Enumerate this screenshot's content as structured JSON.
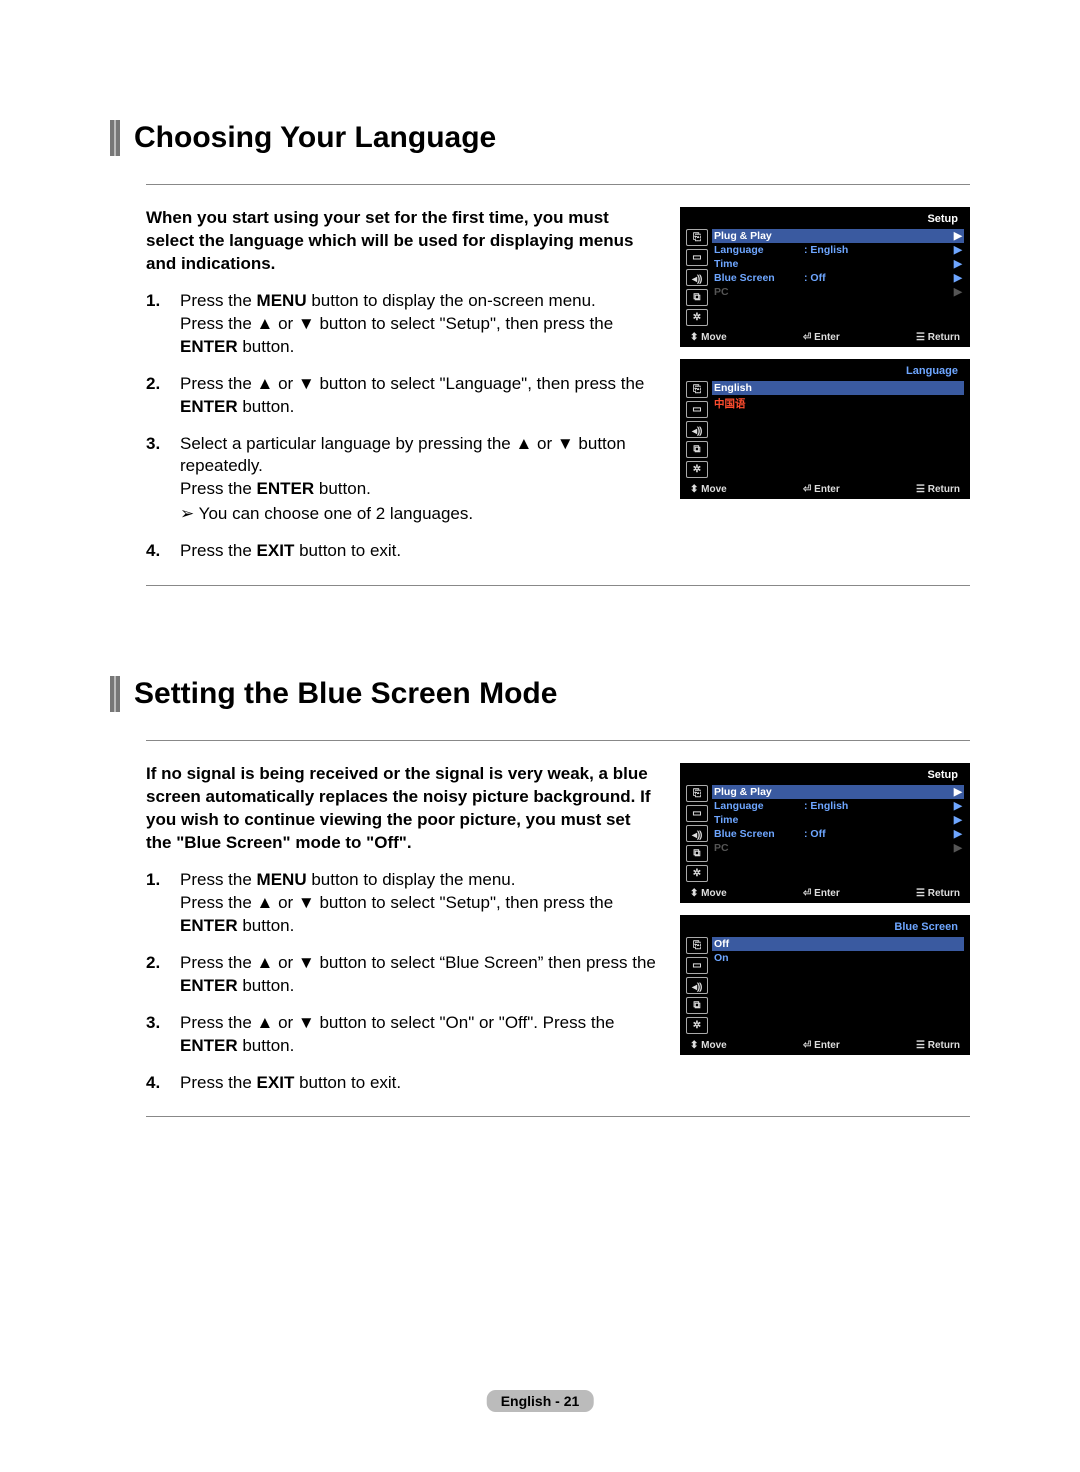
{
  "section1": {
    "title": "Choosing Your Language",
    "intro": "When you start using your set for the first time, you must select the language which will be used for displaying menus and indications.",
    "steps": {
      "s1a": "Press the ",
      "s1b": "MENU",
      "s1c": " button to display the on-screen menu.\nPress the ▲ or ▼ button to select \"Setup\", then press the ",
      "s1d": "ENTER",
      "s1e": " button.",
      "s2a": "Press the ▲ or ▼ button to select \"Language\", then press the ",
      "s2b": "ENTER",
      "s2c": " button.",
      "s3a": "Select a particular language by pressing the ▲ or ▼ button repeatedly.\nPress the ",
      "s3b": "ENTER",
      "s3c": " button.",
      "s3note": "You can choose one of 2 languages.",
      "s4a": "Press the ",
      "s4b": "EXIT",
      "s4c": " button to exit."
    },
    "osd1": {
      "title": "Setup",
      "items": [
        {
          "label": "Plug & Play",
          "value": "",
          "arrow": true,
          "hl": true
        },
        {
          "label": "Language",
          "value": ": English",
          "arrow": true
        },
        {
          "label": "Time",
          "value": "",
          "arrow": true
        },
        {
          "label": "Blue Screen",
          "value": ": Off",
          "arrow": true
        },
        {
          "label": "PC",
          "value": "",
          "arrow": true,
          "dim": true
        }
      ]
    },
    "osd2": {
      "title": "Language",
      "items": [
        {
          "label": "English",
          "hl": true
        },
        {
          "label": "中国语",
          "red": true
        }
      ]
    }
  },
  "section2": {
    "title": "Setting the Blue Screen Mode",
    "intro": "If no signal is being received or the signal is very weak, a blue screen automatically replaces the noisy picture background. If you wish to continue viewing the poor picture, you must set the \"Blue Screen\" mode to \"Off\".",
    "steps": {
      "s1a": "Press the ",
      "s1b": "MENU",
      "s1c": " button to display the menu.\nPress the ▲ or ▼ button to select \"Setup\", then press the ",
      "s1d": "ENTER",
      "s1e": " button.",
      "s2a": "Press the ▲ or ▼ button to select “Blue Screen” then press the ",
      "s2b": "ENTER",
      "s2c": " button.",
      "s3a": "Press the ▲ or ▼ button to select \"On\" or \"Off\". Press the ",
      "s3b": "ENTER",
      "s3c": " button.",
      "s4a": "Press the ",
      "s4b": "EXIT",
      "s4c": " button to exit."
    },
    "osd1": {
      "title": "Setup",
      "items": [
        {
          "label": "Plug & Play",
          "value": "",
          "arrow": true,
          "hl": true
        },
        {
          "label": "Language",
          "value": ": English",
          "arrow": true
        },
        {
          "label": "Time",
          "value": "",
          "arrow": true
        },
        {
          "label": "Blue Screen",
          "value": ": Off",
          "arrow": true
        },
        {
          "label": "PC",
          "value": "",
          "arrow": true,
          "dim": true
        }
      ]
    },
    "osd2": {
      "title": "Blue Screen",
      "items": [
        {
          "label": "Off",
          "hl": true
        },
        {
          "label": "On"
        }
      ]
    }
  },
  "osd_footer": {
    "move": "Move",
    "enter": "Enter",
    "return": "Return"
  },
  "osd_icons": [
    "⎘",
    "▭",
    "◂⸩",
    "⧉",
    "✲"
  ],
  "page_number": "English - 21"
}
